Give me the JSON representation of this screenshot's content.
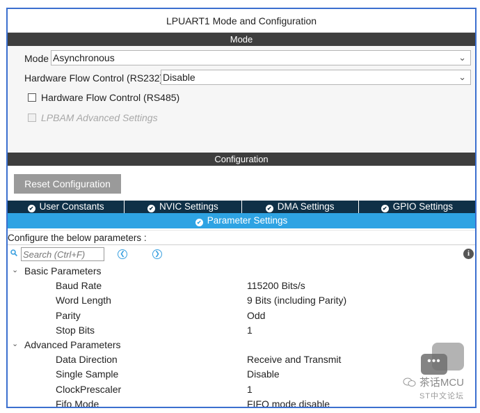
{
  "window": {
    "title": "LPUART1 Mode and Configuration"
  },
  "mode_section": {
    "header": "Mode",
    "mode_label": "Mode",
    "mode_value": "Asynchronous",
    "flow_rs232_label": "Hardware Flow Control (RS232)",
    "flow_rs232_value": "Disable",
    "flow_rs485_label": "Hardware Flow Control (RS485)",
    "lpbam_label": "LPBAM Advanced Settings"
  },
  "config_section": {
    "header": "Configuration",
    "reset_button": "Reset Configuration",
    "tabs": [
      {
        "label": "User Constants",
        "icon": "check-circle-icon"
      },
      {
        "label": "NVIC Settings",
        "icon": "check-circle-icon"
      },
      {
        "label": "DMA Settings",
        "icon": "check-circle-icon"
      },
      {
        "label": "GPIO Settings",
        "icon": "check-circle-icon"
      }
    ],
    "active_tab": "Parameter Settings",
    "configure_text": "Configure the below parameters :",
    "search_placeholder": "Search (Ctrl+F)"
  },
  "parameters": {
    "basic": {
      "label": "Basic Parameters",
      "rows": [
        {
          "name": "Baud Rate",
          "value": "115200 Bits/s"
        },
        {
          "name": "Word Length",
          "value": "9 Bits (including Parity)"
        },
        {
          "name": "Parity",
          "value": "Odd"
        },
        {
          "name": "Stop Bits",
          "value": "1"
        }
      ]
    },
    "advanced": {
      "label": "Advanced Parameters",
      "rows": [
        {
          "name": "Data Direction",
          "value": "Receive and Transmit"
        },
        {
          "name": "Single Sample",
          "value": "Disable"
        },
        {
          "name": "ClockPrescaler",
          "value": "1"
        },
        {
          "name": "Fifo Mode",
          "value": "FIFO mode disable"
        }
      ]
    }
  },
  "watermark": {
    "text": "茶话MCU",
    "sub": "ST中文论坛"
  },
  "colors": {
    "border": "#3b6fcf",
    "tab_bar": "#0f3047",
    "active_tab": "#2ea3e3",
    "section_bar": "#3e3e3e"
  }
}
